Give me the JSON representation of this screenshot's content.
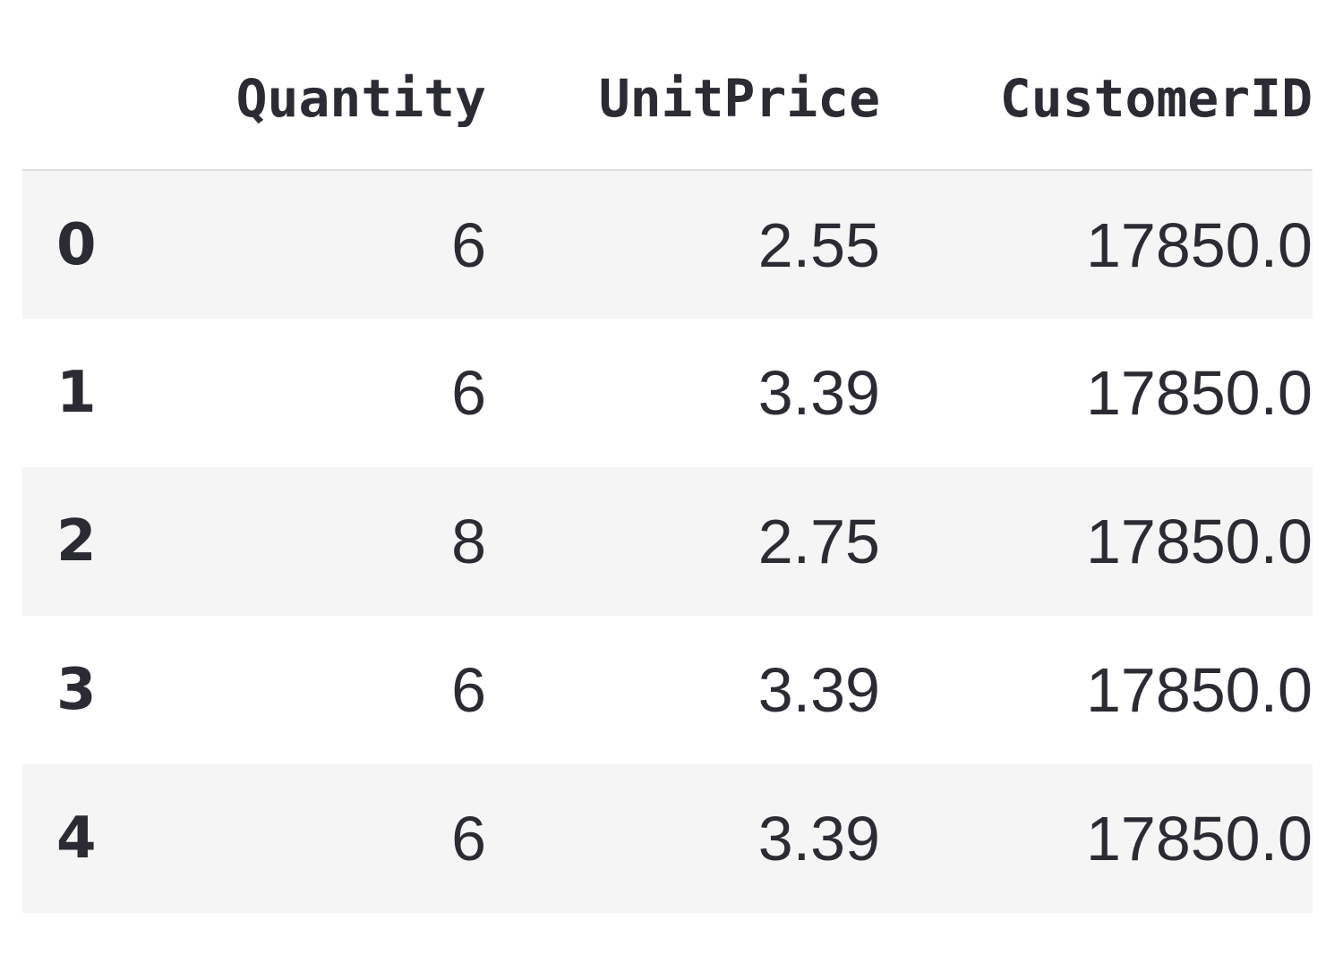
{
  "table": {
    "index_header": "",
    "columns": [
      "Quantity",
      "UnitPrice",
      "CustomerID"
    ],
    "rows": [
      {
        "index": "0",
        "values": [
          "6",
          "2.55",
          "17850.0"
        ]
      },
      {
        "index": "1",
        "values": [
          "6",
          "3.39",
          "17850.0"
        ]
      },
      {
        "index": "2",
        "values": [
          "8",
          "2.75",
          "17850.0"
        ]
      },
      {
        "index": "3",
        "values": [
          "6",
          "3.39",
          "17850.0"
        ]
      },
      {
        "index": "4",
        "values": [
          "6",
          "3.39",
          "17850.0"
        ]
      }
    ]
  },
  "colors": {
    "text": "#2b2b33",
    "stripe": "#f5f5f5",
    "header_rule": "#dcdcdc"
  }
}
